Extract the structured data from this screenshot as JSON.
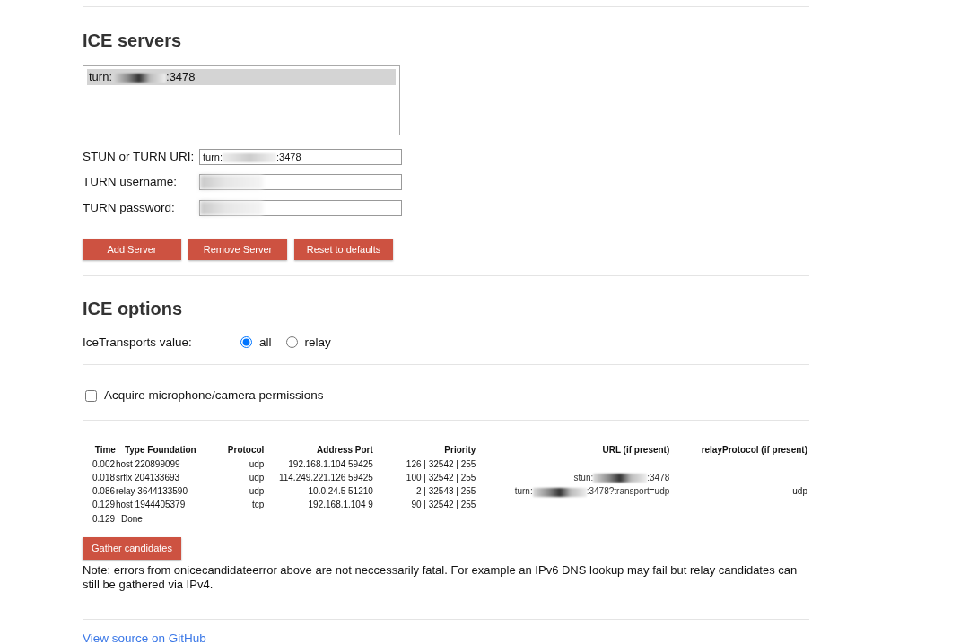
{
  "servers": {
    "title": "ICE servers",
    "list": [
      {
        "before": "turn:",
        "after": ":3478",
        "redacted": true,
        "selected": true
      }
    ],
    "fields": [
      {
        "label": "STUN or TURN URI:",
        "value_before": "turn:",
        "value_after": ":3478",
        "redacted": true
      },
      {
        "label": "TURN username:",
        "redacted": true
      },
      {
        "label": "TURN password:",
        "redacted": true
      }
    ],
    "buttons": [
      "Add Server",
      "Remove Server",
      "Reset to defaults"
    ]
  },
  "options": {
    "title": "ICE options",
    "label": "IceTransports value:",
    "radios": [
      {
        "label": "all",
        "selected": true
      },
      {
        "label": "relay",
        "selected": false
      }
    ]
  },
  "permissions": {
    "label": "Acquire microphone/camera permissions",
    "checked": false
  },
  "candidates": {
    "columns": [
      "Time",
      "Type Foundation",
      "Protocol",
      "Address Port",
      "Priority",
      "URL (if present)",
      "relayProtocol (if present)"
    ],
    "rows": [
      {
        "time": "0.002",
        "type": "host 220899099",
        "protocol": "udp",
        "address": "192.168.1.104 59425",
        "priority": "126 | 32542 | 255"
      },
      {
        "time": "0.018",
        "type": "srflx 204133693",
        "protocol": "udp",
        "address": "114.249.221.126 59425",
        "priority": "100 | 32542 | 255",
        "url": {
          "before": "stun:",
          "after": ":3478",
          "redacted": true
        }
      },
      {
        "time": "0.086",
        "type": "relay 3644133590",
        "protocol": "udp",
        "address": "10.0.24.5 51210",
        "priority": "2 | 32543 | 255",
        "url": {
          "before": "turn:",
          "after": ":3478?transport=udp",
          "redacted": true
        },
        "relay_protocol": "udp"
      },
      {
        "time": "0.129",
        "type": "host 1944405379",
        "protocol": "tcp",
        "address": "192.168.1.104 9",
        "priority": "90 | 32542 | 255"
      },
      {
        "time": "0.129",
        "type": "Done"
      }
    ]
  },
  "gather_button": "Gather candidates",
  "note": "Note: errors from onicecandidateerror above are not neccessarily fatal. For example an IPv6 DNS lookup may fail but relay candidates can still be gathered via IPv4.",
  "footer_link": "View source on GitHub"
}
